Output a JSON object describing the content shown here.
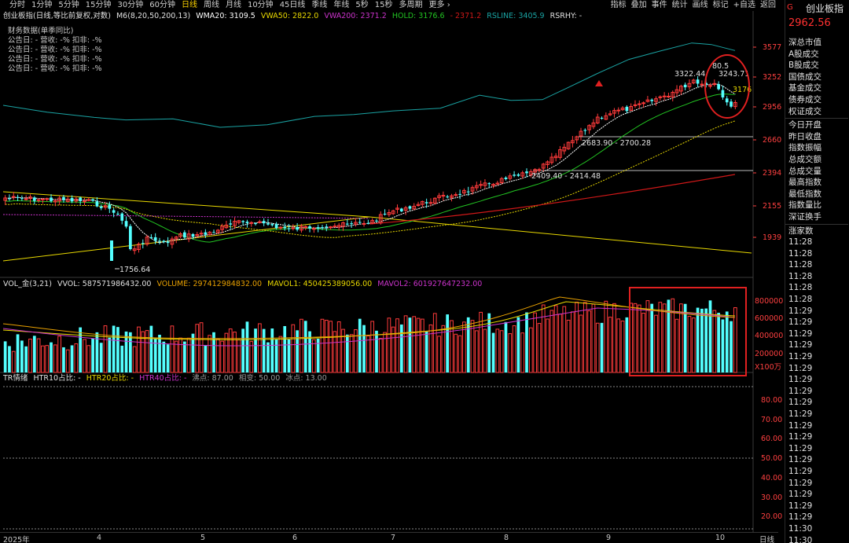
{
  "toolbar": {
    "periods": [
      "分时",
      "1分钟",
      "5分钟",
      "15分钟",
      "30分钟",
      "60分钟",
      "日线",
      "周线",
      "月线",
      "10分钟",
      "45日线",
      "季线",
      "年线",
      "5秒",
      "15秒",
      "多周期",
      "更多 ›"
    ],
    "active_period": "日线",
    "right": [
      "指标",
      "叠加",
      "事件",
      "统计",
      "画线",
      "标记",
      "+自选",
      "返回"
    ]
  },
  "main_title": {
    "name": "创业板指(日线,等比前复权,对数)",
    "indicator": "M6(8,20,50,200,13)",
    "wma20": "WMA20: 3109.5",
    "vwa50": "VWA50: 2822.0",
    "vwa200": "VWA200: 2371.2",
    "hold": "HOLD: 3176.6",
    "hold2": "- 2371.2",
    "rsline": "RSLINE: 3405.9",
    "rsrhy": "RSRHY: -"
  },
  "colors": {
    "up": "#ff3b3b",
    "down": "#54ffff",
    "ma8": "#ffffff",
    "ma_green": "#22c422",
    "ma_yellow": "#e8d800",
    "ma_red": "#d01818",
    "purple": "#cc33cc",
    "rs": "#1aa3a3",
    "highlight": "#e02020"
  },
  "finance": {
    "title": "财务数据(单季同比)",
    "rows": [
      "公告日: -   营收: -%   扣非: -%",
      "公告日: -   营收: -%   扣非: -%",
      "公告日: -   营收: -%   扣非: -%",
      "公告日: -   营收: -%   扣非: -%"
    ]
  },
  "price_axis": [
    "3577",
    "3252",
    "2956",
    "2660",
    "2394",
    "2155",
    "1939"
  ],
  "annotations": {
    "low": "1756.64",
    "mid1": "2409.40 - 2414.48",
    "mid2": "2683.90 - 2700.28",
    "high1": "3322.44",
    "high2": "3243.71",
    "peak": "80.5",
    "last": "3176"
  },
  "volume": {
    "title": "VOL_金(3,21)",
    "vvol": "VVOL: 587571986432.00",
    "volume": "VOLUME: 297412984832.00",
    "mavol1": "MAVOL1: 450425389056.00",
    "mavol2": "MAVOL2: 601927647232.00",
    "axis": [
      "800000",
      "600000",
      "400000",
      "200000"
    ],
    "unit": "X100万"
  },
  "tr": {
    "title": "TR情绪",
    "htr10": "HTR10占比: -",
    "htr20": "HTR20占比: -",
    "htr40": "HTR40占比: -",
    "boil": "沸点: 87.00",
    "phase": "相变: 50.00",
    "ice": "冰点: 13.00",
    "axis": [
      "80.00",
      "70.00",
      "60.00",
      "50.00",
      "40.00",
      "30.00",
      "20.00"
    ]
  },
  "x_axis": {
    "labels": [
      "2025年",
      "4",
      "5",
      "6",
      "7",
      "8",
      "9",
      "10"
    ],
    "mode": "日线"
  },
  "side": {
    "g": "G",
    "name": "创业板指",
    "value": "2962.56",
    "menu": [
      "深总市值",
      "A股成交",
      "B股成交",
      "国债成交",
      "基金成交",
      "债券成交",
      "权证成交",
      "今日开盘",
      "昨日收盘",
      "指数振幅",
      "总成交额",
      "总成交量",
      "最高指数",
      "最低指数",
      "指数量比",
      "深证换手",
      "涨家数"
    ],
    "times": [
      "11:28",
      "11:28",
      "11:28",
      "11:28",
      "11:28",
      "11:28",
      "11:29",
      "11:29",
      "11:29",
      "11:29",
      "11:29",
      "11:29",
      "11:29",
      "11:29",
      "11:29",
      "11:29",
      "11:29",
      "11:29",
      "11:29",
      "11:29",
      "11:29",
      "11:29",
      "11:29",
      "11:29",
      "11:29",
      "11:30",
      "11:30"
    ]
  }
}
